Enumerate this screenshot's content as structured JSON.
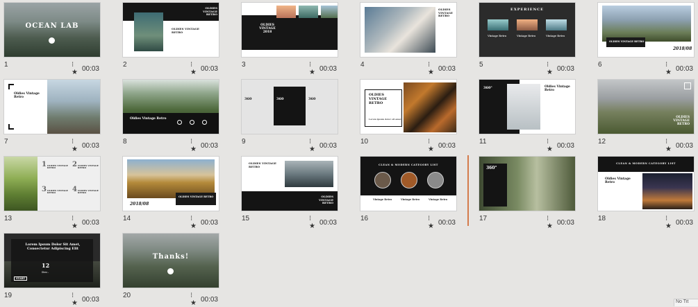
{
  "slides": [
    {
      "num": "1",
      "duration": "00:03",
      "title": "OCEAN LAB"
    },
    {
      "num": "2",
      "duration": "00:03",
      "title": "OLDIES VINTAGE RETRO"
    },
    {
      "num": "3",
      "duration": "00:03",
      "title": "OLDIES VINTAGE 2018"
    },
    {
      "num": "4",
      "duration": "00:03",
      "title": "OLDIES VINTAGE RETRO"
    },
    {
      "num": "5",
      "duration": "00:03",
      "title": "EXPERIENCE"
    },
    {
      "num": "6",
      "duration": "00:03",
      "title": "2018/08"
    },
    {
      "num": "7",
      "duration": "00:03",
      "title": "Oldies Vintage Retro"
    },
    {
      "num": "8",
      "duration": "00:03",
      "title": "Oldies Vintage Retro"
    },
    {
      "num": "9",
      "duration": "00:03",
      "title": "360"
    },
    {
      "num": "10",
      "duration": "00:03",
      "title": "OLDIES VINTAGE RETRO"
    },
    {
      "num": "11",
      "duration": "00:03",
      "title": "Oldies Vintage Retro"
    },
    {
      "num": "12",
      "duration": "00:03",
      "title": "OLDIES VINTAGE RETRO"
    },
    {
      "num": "13",
      "duration": "00:03",
      "title": "OLDIES VINTAGE RETRO"
    },
    {
      "num": "14",
      "duration": "00:03",
      "title": "2018/08"
    },
    {
      "num": "15",
      "duration": "00:03",
      "title": "OLDIES VINTAGE RETRO"
    },
    {
      "num": "16",
      "duration": "00:03",
      "title": "CLEAN & MODERN CATEGORY LIST"
    },
    {
      "num": "17",
      "duration": "00:03",
      "title": "360°"
    },
    {
      "num": "18",
      "duration": "00:03",
      "title": "Oldies Vintage Retro"
    },
    {
      "num": "19",
      "duration": "00:03",
      "title": "Lorem Ipsum Dolor Sit Amet, Consectetur Adipiscing Elit"
    },
    {
      "num": "20",
      "duration": "00:03",
      "title": "Thanks!"
    }
  ],
  "extra": {
    "s5_caption": "Vintage Retro",
    "s10_sub": "Lorem ipsum dolor sit amet",
    "s13_n1": "1",
    "s13_n2": "2",
    "s13_n3": "3",
    "s13_n4": "4",
    "s14_sub": "OLDIES VINTAGE RETRO",
    "s16_cap": "Vintage Retro",
    "s18_title": "CLEAN & MODERN CATEGORY LIST",
    "s19_day": "12",
    "s19_month": "Dec.",
    "s19_btn": "START",
    "s6_sub": "OLDIES VINTAGE RETRO"
  },
  "corner_label": "No Tit",
  "anim_icon": "⁝★",
  "colors": {
    "bg": "#e6e5e3",
    "accent": "#d47a4a"
  }
}
